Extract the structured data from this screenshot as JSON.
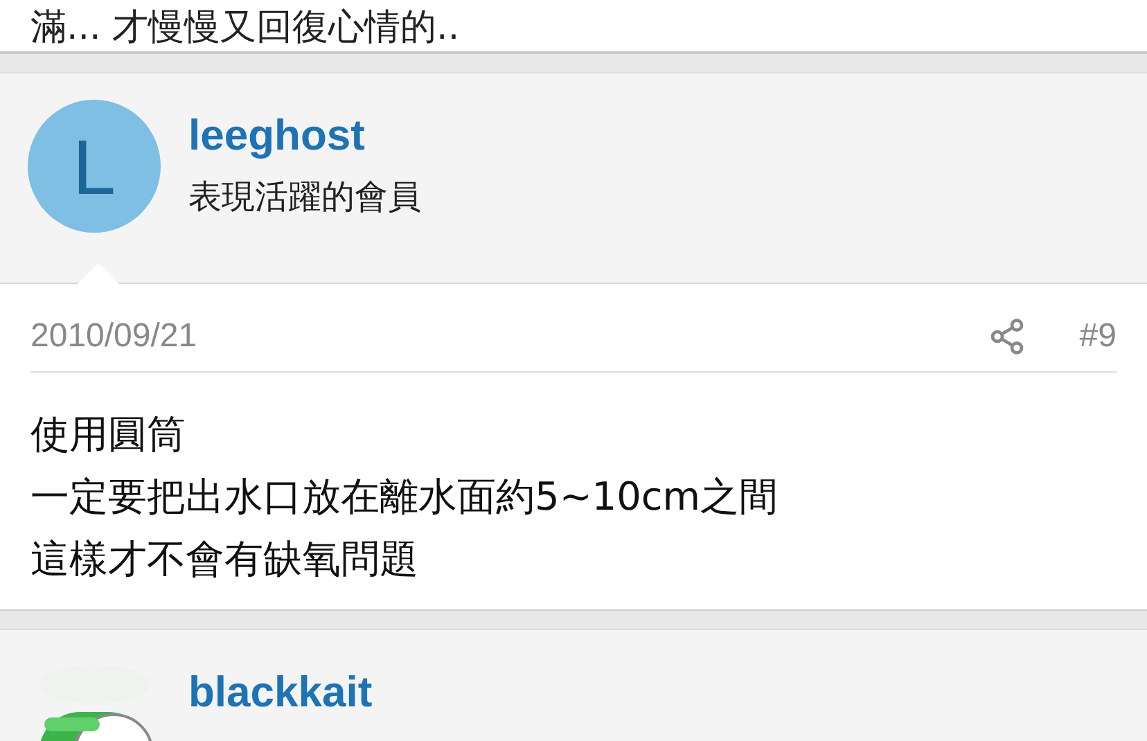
{
  "previous_post": {
    "text": "滿... 才慢慢又回復心情的.."
  },
  "posts": [
    {
      "author": {
        "name": "leeghost",
        "title": "表現活躍的會員",
        "avatar": {
          "kind": "letter",
          "letter": "L"
        }
      },
      "date": "2010/09/21",
      "number": "#9",
      "lines": [
        "使用圓筒",
        "一定要把出水口放在離水面約5~10cm之間",
        "這樣才不會有缺氧問題"
      ]
    },
    {
      "author": {
        "name": "blackkait"
      }
    }
  ]
}
